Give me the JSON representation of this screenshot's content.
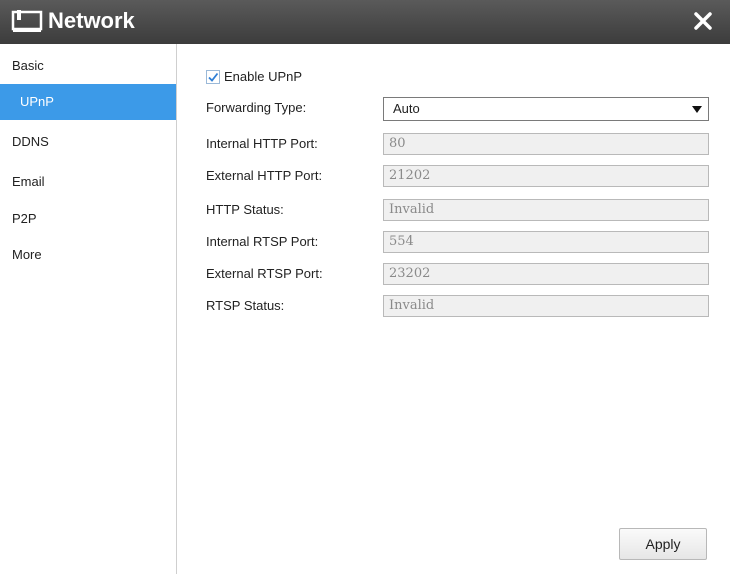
{
  "window": {
    "title": "Network",
    "title_icon": "monitor-icon",
    "close_icon": "close-icon"
  },
  "sidebar": {
    "items": [
      {
        "label": "Basic",
        "active": false
      },
      {
        "label": "UPnP",
        "active": true
      },
      {
        "label": "DDNS",
        "active": false
      },
      {
        "label": "Email",
        "active": false
      },
      {
        "label": "P2P",
        "active": false
      },
      {
        "label": "More",
        "active": false
      }
    ],
    "active_color": "#3c9ae8"
  },
  "upnp": {
    "enable_label": "Enable UPnP",
    "enable_checked": true,
    "forwarding_type_label": "Forwarding Type:",
    "forwarding_type_value": "Auto",
    "internal_http_label": "Internal HTTP Port:",
    "internal_http_value": "80",
    "external_http_label": "External HTTP Port:",
    "external_http_value": "21202",
    "http_status_label": "HTTP Status:",
    "http_status_value": "Invalid",
    "internal_rtsp_label": "Internal RTSP Port:",
    "internal_rtsp_value": "554",
    "external_rtsp_label": "External RTSP Port:",
    "external_rtsp_value": "23202",
    "rtsp_status_label": "RTSP Status:",
    "rtsp_status_value": "Invalid",
    "apply_label": "Apply"
  }
}
